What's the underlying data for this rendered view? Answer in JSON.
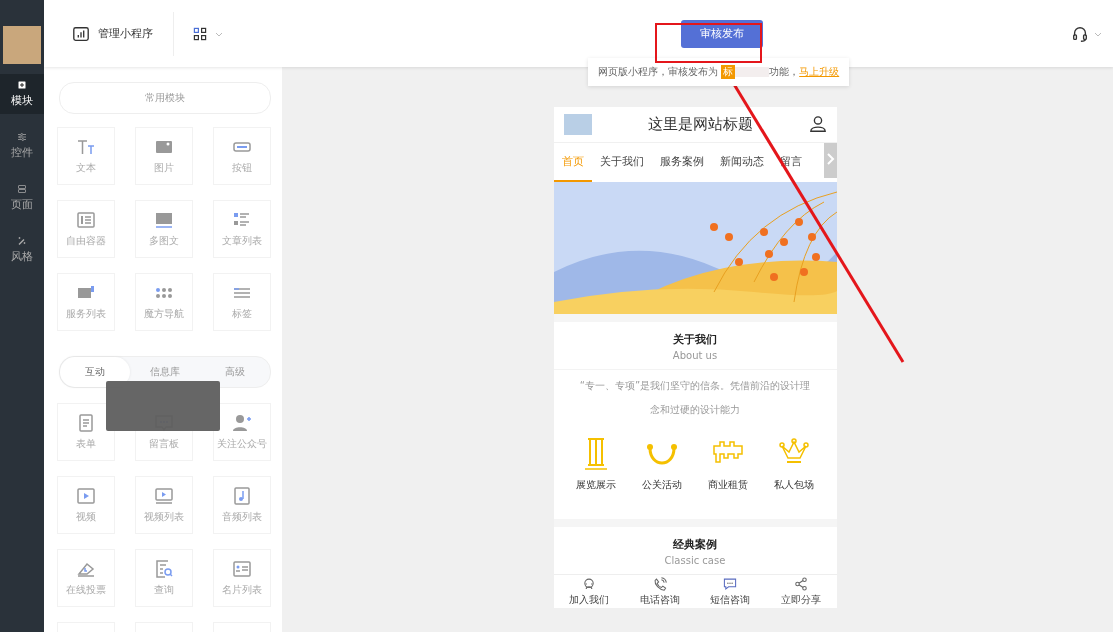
{
  "sidebar": {
    "items": [
      {
        "label": "模块",
        "selected": true
      },
      {
        "label": "控件",
        "selected": false
      },
      {
        "label": "页面",
        "selected": false
      },
      {
        "label": "风格",
        "selected": false
      }
    ]
  },
  "header": {
    "manage": "管理小程序",
    "publish": "审核发布",
    "notice": {
      "text": "网页版小程序，审核发布为",
      "badge": "标",
      "suffix": "功能，",
      "link": "马上升级"
    }
  },
  "panel": {
    "common": "常用模块",
    "common_modules": [
      "文本",
      "图片",
      "按钮",
      "自由容器",
      "多图文",
      "文章列表",
      "服务列表",
      "魔方导航",
      "标签"
    ],
    "tabs": [
      {
        "label": "互动",
        "selected": true
      },
      {
        "label": "信息库",
        "selected": false
      },
      {
        "label": "高级",
        "selected": false
      }
    ],
    "modules": [
      "表单",
      "留言板",
      "关注公众号",
      "视频",
      "视频列表",
      "音频列表",
      "在线投票",
      "查询",
      "名片列表"
    ]
  },
  "phone": {
    "title": "这里是网站标题",
    "nav": [
      {
        "label": "首页",
        "selected": true
      },
      {
        "label": "关于我们",
        "selected": false
      },
      {
        "label": "服务案例",
        "selected": false
      },
      {
        "label": "新闻动态",
        "selected": false
      },
      {
        "label": "留言",
        "selected": false
      }
    ],
    "about": {
      "title": "关于我们",
      "subtitle": "About us",
      "desc": "“专一、专项”是我们坚守的信条。凭借前沿的设计理念和过硬的设计能力",
      "features": [
        "展览展示",
        "公关活动",
        "商业租赁",
        "私人包场"
      ]
    },
    "cases": {
      "title": "经典案例",
      "subtitle": "Classic case"
    },
    "bottom": [
      "加入我们",
      "电话咨询",
      "短信咨询",
      "立即分享"
    ]
  }
}
